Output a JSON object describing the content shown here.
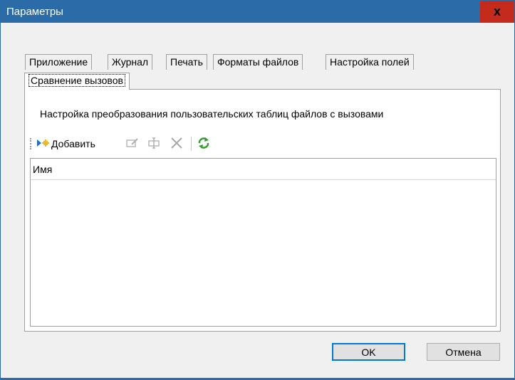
{
  "window": {
    "title": "Параметры",
    "close_label": "x"
  },
  "tabs": [
    {
      "label": "Приложение",
      "active": false
    },
    {
      "label": "Журнал",
      "active": false
    },
    {
      "label": "Печать",
      "active": false
    },
    {
      "label": "Форматы файлов",
      "active": false
    },
    {
      "label": "Настройка полей",
      "active": false
    },
    {
      "label": "Сравнение вызовов",
      "active": true
    }
  ],
  "panel": {
    "description": "Настройка преобразования пользовательских таблиц файлов с вызовами",
    "toolbar": {
      "add_label": "Добавить",
      "buttons": [
        "add-icon",
        "edit-icon",
        "rename-icon",
        "delete-icon",
        "refresh-icon"
      ]
    },
    "grid": {
      "columns": [
        "Имя"
      ],
      "rows": []
    }
  },
  "buttons": {
    "ok": "OK",
    "cancel": "Отмена"
  },
  "colors": {
    "titlebar": "#2b6ca8",
    "close": "#c42b1c",
    "dialog_bg": "#f0f0f0"
  }
}
